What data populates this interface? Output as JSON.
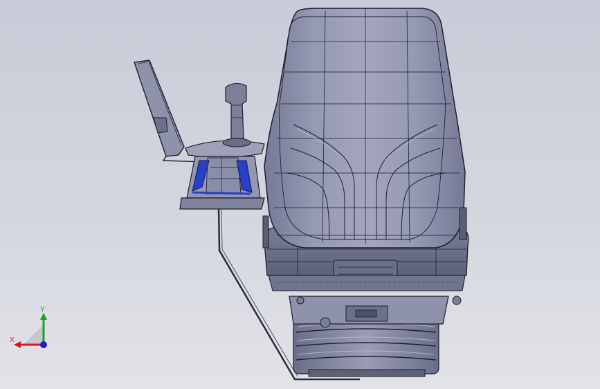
{
  "viewport": {
    "background_top": "#c9ccd8",
    "background_bottom": "#e2e3e8",
    "model_fill": "#8a8ea8",
    "model_edge": "#1e2030",
    "accent_blue": "#2a3fc8"
  },
  "triad": {
    "x_label": "X",
    "y_label": "Y",
    "x_color": "#c81e1e",
    "y_color": "#1ea01e",
    "z_color": "#1e1ec8"
  }
}
